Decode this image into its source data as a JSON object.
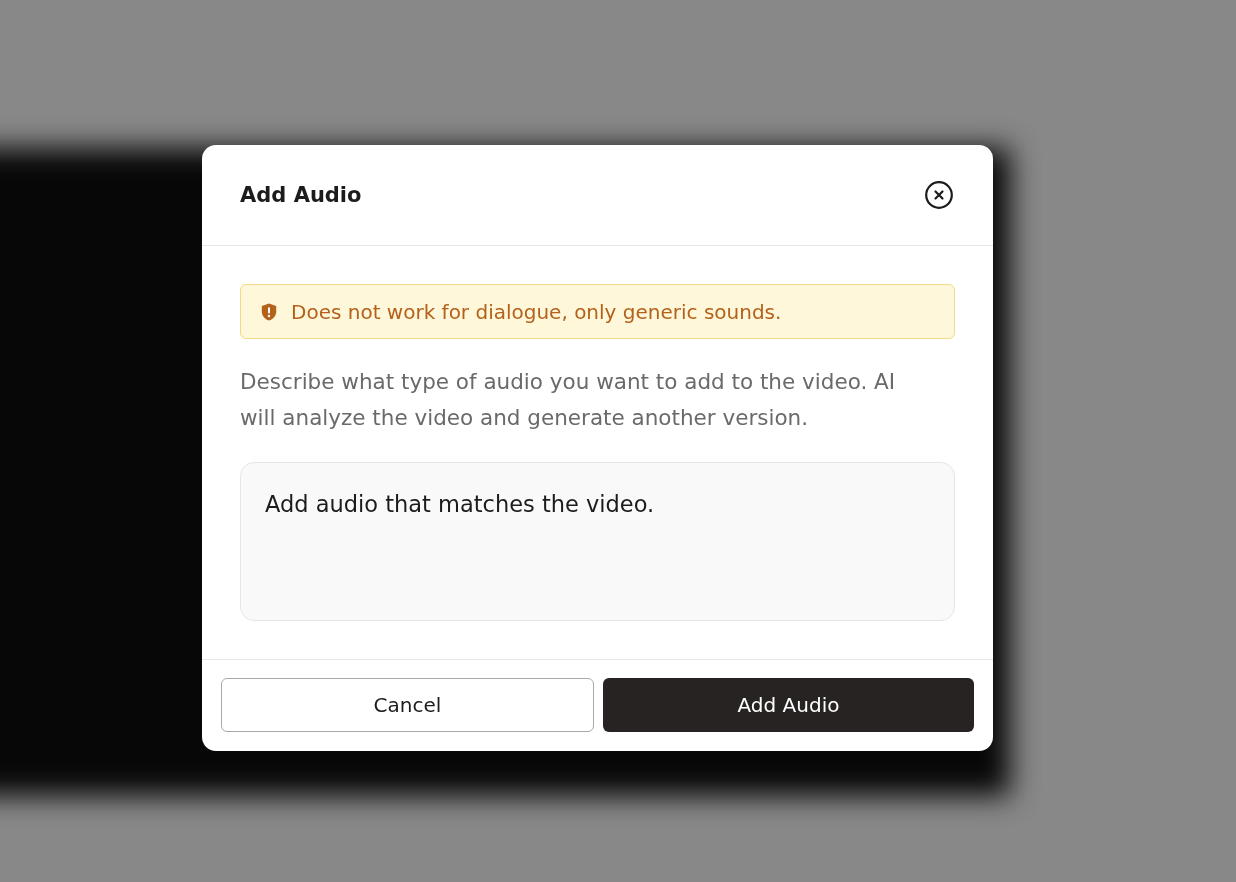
{
  "dialog": {
    "title": "Add Audio",
    "alert": {
      "text": "Does not work for dialogue, only generic sounds."
    },
    "description": "Describe what type of audio you want to add to the video. AI will analyze the video and generate another version.",
    "prompt_field": {
      "value": "Add audio that matches the video."
    },
    "buttons": [
      {
        "label": "Cancel",
        "kind": "secondary"
      },
      {
        "label": "Add Audio",
        "kind": "primary"
      }
    ]
  }
}
